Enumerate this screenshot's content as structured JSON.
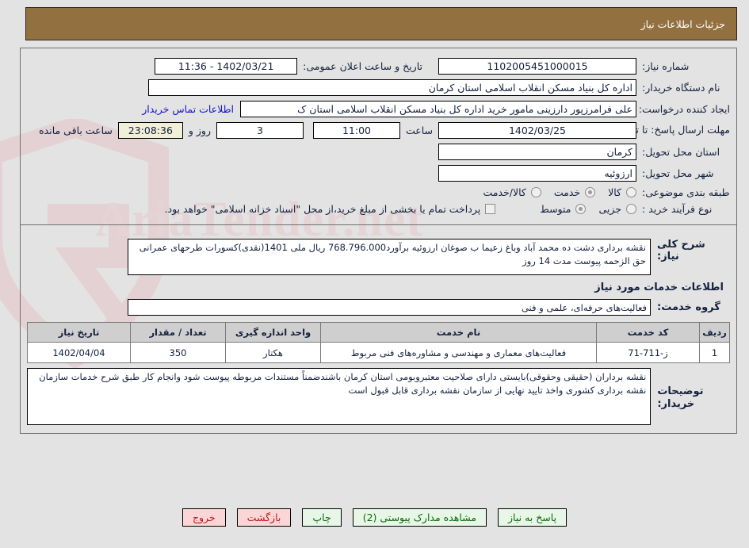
{
  "header": {
    "title": "جزئیات اطلاعات نیاز"
  },
  "form": {
    "need_number_label": "شماره نیاز:",
    "need_number_value": "1102005451000015",
    "announce_label": "تاریخ و ساعت اعلان عمومی:",
    "announce_value": "1402/03/21 - 11:36",
    "buyer_org_label": "نام دستگاه خریدار:",
    "buyer_org_value": "اداره کل بنیاد مسکن انقلاب اسلامی استان کرمان",
    "creator_label": "ایجاد کننده درخواست:",
    "creator_value": "علی فرامرزپور دارزینی مامور خرید اداره کل بنیاد مسکن انقلاب اسلامی استان ک",
    "contact_link": "اطلاعات تماس خریدار",
    "deadline_label": "مهلت ارسال پاسخ: تا تاریخ:",
    "deadline_date": "1402/03/25",
    "deadline_time_label": "ساعت",
    "deadline_time": "11:00",
    "days_value": "3",
    "days_label": "روز و",
    "countdown": "23:08:36",
    "remaining_label": "ساعت باقی مانده",
    "province_label": "استان محل تحویل:",
    "province_value": "کرمان",
    "city_label": "شهر محل تحویل:",
    "city_value": "ارزوئیه",
    "category_label": "طبقه بندی موضوعی:",
    "category_options": [
      {
        "label": "کالا",
        "selected": false
      },
      {
        "label": "خدمت",
        "selected": true
      },
      {
        "label": "کالا/خدمت",
        "selected": false
      }
    ],
    "process_label": "نوع فرآیند خرید :",
    "process_options": [
      {
        "label": "جزیی",
        "selected": false
      },
      {
        "label": "متوسط",
        "selected": true
      }
    ],
    "treasury_note": "پرداخت تمام یا بخشی از مبلغ خرید،از محل \"اسناد خزانه اسلامی\" خواهد بود."
  },
  "description": {
    "label": "شرح کلی نیاز:",
    "value": "نقشه برداری دشت ده محمد آباد وباغ زعیما ب صوغان ارزوئیه برآورد768.796.000 ریال ملی 1401(نقدی)کسورات طرحهای عمرانی حق الزحمه پیوست مدت 14 روز"
  },
  "services_section": {
    "title": "اطلاعات خدمات مورد نیاز",
    "group_label": "گروه خدمت:",
    "group_value": "فعالیت‌های حرفه‌ای، علمی و فنی"
  },
  "table": {
    "columns": [
      "ردیف",
      "کد خدمت",
      "نام خدمت",
      "واحد اندازه گیری",
      "تعداد / مقدار",
      "تاریخ نیاز"
    ],
    "rows": [
      {
        "row": "1",
        "code": "ز-711-71",
        "name": "فعالیت‌های معماری و مهندسی و مشاوره‌های فنی مربوط",
        "unit": "هکتار",
        "qty": "350",
        "date": "1402/04/04"
      }
    ]
  },
  "buyer_notes": {
    "label": "توضیحات خریدار:",
    "value": "نقشه برداران (حقیقی وحقوقی)بایستی دارای صلاحیت معتبروبومی استان کرمان باشندضمناً مستندات مربوطه پیوست شود وانجام کار طبق شرح خدمات سازمان نقشه برداری کشوری واخذ تایید نهایی از سازمان نقشه برداری قابل قبول است"
  },
  "footer": {
    "buttons": [
      {
        "label": "پاسخ به نیاز",
        "style": "green"
      },
      {
        "label": "مشاهده مدارک پیوستی (2)",
        "style": "green"
      },
      {
        "label": "چاپ",
        "style": "green"
      },
      {
        "label": "بازگشت",
        "style": "pink"
      },
      {
        "label": "خروج",
        "style": "pink"
      }
    ]
  },
  "watermark": {
    "text": "AriaTender.net"
  },
  "colors": {
    "titlebar": "#93703f",
    "link": "#1414c8",
    "countdown_bg": "#f2efd8",
    "btn_green_bg": "#e8f6e8",
    "btn_pink_bg": "#fbd6d6"
  }
}
